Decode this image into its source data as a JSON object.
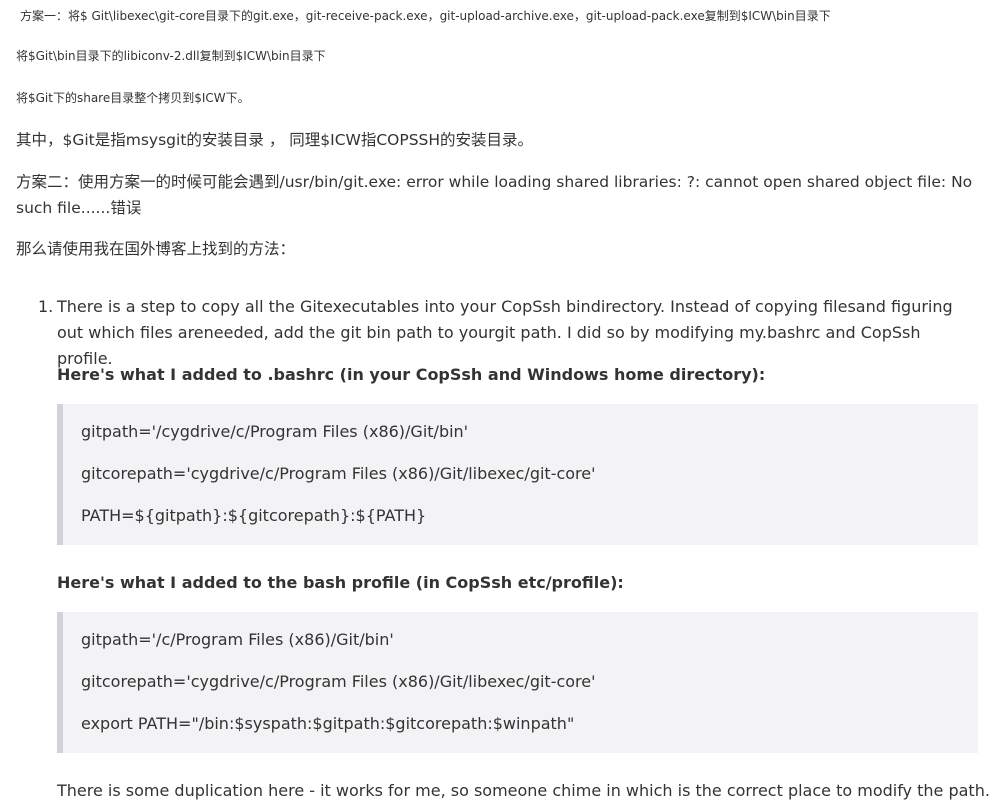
{
  "paragraphs": {
    "p1": "方案一：将$ Git\\libexec\\git-core目录下的git.exe，git-receive-pack.exe，git-upload-archive.exe，git-upload-pack.exe复制到$ICW\\bin目录下",
    "p2": "将$Git\\bin目录下的libiconv-2.dll复制到$ICW\\bin目录下",
    "p3": "将$Git下的share目录整个拷贝到$ICW下。",
    "p4": "其中，$Git是指msysgit的安装目录 ， 同理$ICW指COPSSH的安装目录。",
    "p5": "方案二：使用方案一的时候可能会遇到/usr/bin/git.exe: error while loading shared libraries: ?: cannot open shared object file: No such file......错误",
    "p6": "那么请使用我在国外博客上找到的方法："
  },
  "list": {
    "number": "1.",
    "text": "There is a step to copy all the Gitexecutables into your CopSsh bindirectory. Instead of copying filesand figuring out which files areneeded, add the git bin path to yourgit path. I did so by modifying my.bashrc and CopSsh profile.",
    "heading1": "Here's what I added to .bashrc (in your CopSsh and Windows home directory):",
    "code1": [
      "gitpath='/cygdrive/c/Program Files (x86)/Git/bin'",
      "gitcorepath='cygdrive/c/Program Files (x86)/Git/libexec/git-core'",
      "PATH=${gitpath}:${gitcorepath}:${PATH}"
    ],
    "heading2": "Here's what I added to the bash profile (in CopSsh etc/profile):",
    "code2": [
      "gitpath='/c/Program Files (x86)/Git/bin'",
      "gitcorepath='cygdrive/c/Program Files (x86)/Git/libexec/git-core'",
      "export PATH=\"/bin:$syspath:$gitpath:$gitcorepath:$winpath\""
    ],
    "closing": "There is some duplication here - it works for me, so someone chime in which is the correct place to modify the path."
  }
}
